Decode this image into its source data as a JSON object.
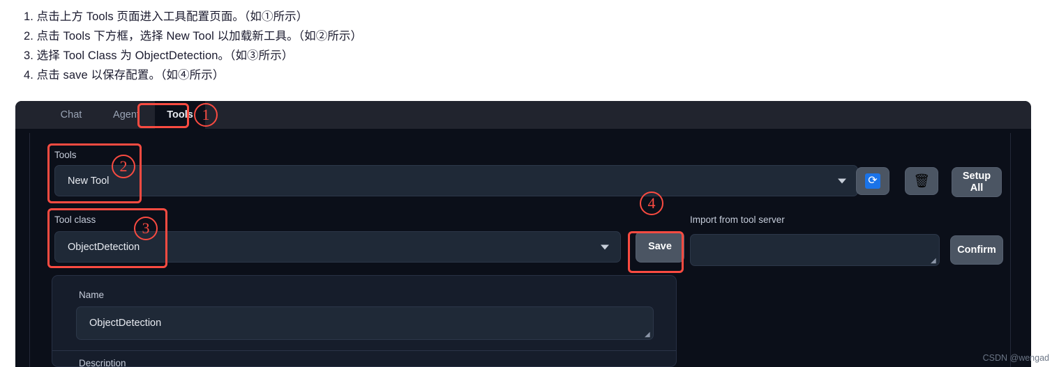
{
  "instructions": [
    "1. 点击上方 Tools 页面进入工具配置页面。（如①所示）",
    "2. 点击 Tools 下方框，选择 New Tool 以加载新工具。（如②所示）",
    "3. 选择 Tool Class 为 ObjectDetection。（如③所示）",
    "4. 点击 save 以保存配置。（如④所示）"
  ],
  "app": {
    "tabs": [
      {
        "id": "chat",
        "label": "Chat",
        "active": false
      },
      {
        "id": "agent",
        "label": "Agent",
        "active": false
      },
      {
        "id": "tools",
        "label": "Tools",
        "active": true
      }
    ],
    "tools_section": {
      "label": "Tools",
      "selected": "New Tool",
      "caret_icon": "chevron-down-icon",
      "refresh_icon": "refresh-icon",
      "refresh_glyph": "⟳",
      "delete_icon": "trash-icon",
      "delete_glyph": "🗑",
      "setup_all_label": "Setup\nAll",
      "setup_all_line1": "Setup",
      "setup_all_line2": "All"
    },
    "tool_class_section": {
      "label": "Tool class",
      "selected": "ObjectDetection",
      "caret_icon": "chevron-down-icon"
    },
    "save_button": "Save",
    "import_section": {
      "label": "Import from tool server",
      "value": "",
      "placeholder": "",
      "confirm_label": "Confirm"
    },
    "detail_card": {
      "name_label": "Name",
      "name_value": "ObjectDetection",
      "description_label": "Description"
    }
  },
  "annotations": {
    "markers": [
      "①",
      "②",
      "③",
      "④"
    ],
    "color": "#fb4b41"
  },
  "watermark": "CSDN @wengad"
}
